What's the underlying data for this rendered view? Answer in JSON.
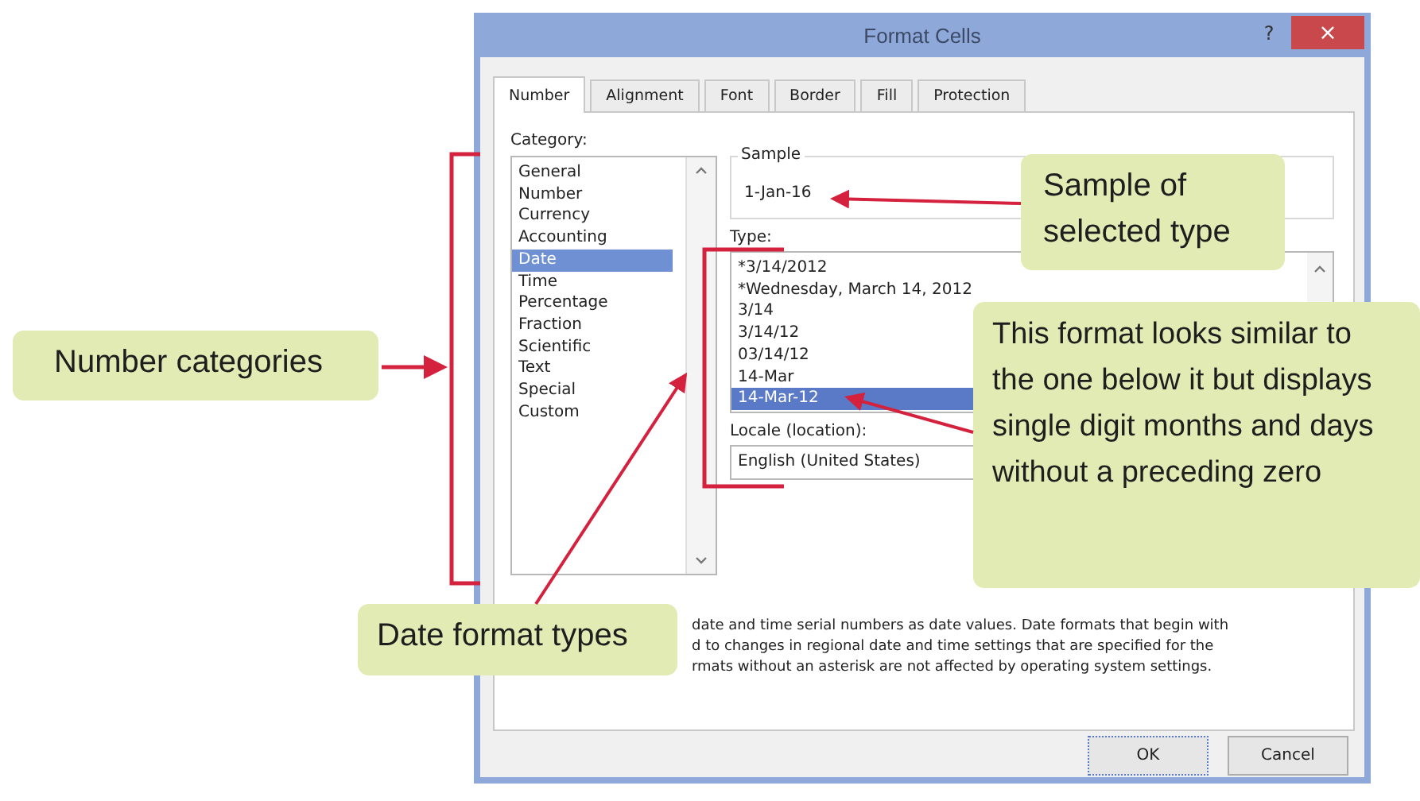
{
  "window": {
    "title": "Format Cells"
  },
  "title_buttons": [
    {
      "kind": "help",
      "label": "?"
    },
    {
      "kind": "close",
      "label": "×"
    }
  ],
  "tabs": [
    {
      "label": "Number",
      "selected": true
    },
    {
      "label": "Alignment",
      "selected": false
    },
    {
      "label": "Font",
      "selected": false
    },
    {
      "label": "Border",
      "selected": false
    },
    {
      "label": "Fill",
      "selected": false
    },
    {
      "label": "Protection",
      "selected": false
    }
  ],
  "category": {
    "label": "Category:",
    "items": [
      {
        "label": "General",
        "selected": false
      },
      {
        "label": "Number",
        "selected": false
      },
      {
        "label": "Currency",
        "selected": false
      },
      {
        "label": "Accounting",
        "selected": false
      },
      {
        "label": "Date",
        "selected": true
      },
      {
        "label": "Time",
        "selected": false
      },
      {
        "label": "Percentage",
        "selected": false
      },
      {
        "label": "Fraction",
        "selected": false
      },
      {
        "label": "Scientific",
        "selected": false
      },
      {
        "label": "Text",
        "selected": false
      },
      {
        "label": "Special",
        "selected": false
      },
      {
        "label": "Custom",
        "selected": false
      }
    ]
  },
  "sample": {
    "label": "Sample",
    "value": "1-Jan-16"
  },
  "type": {
    "label": "Type:",
    "items": [
      {
        "label": "*3/14/2012",
        "selected": false
      },
      {
        "label": "*Wednesday, March 14, 2012",
        "selected": false
      },
      {
        "label": "3/14",
        "selected": false
      },
      {
        "label": "3/14/12",
        "selected": false
      },
      {
        "label": "03/14/12",
        "selected": false
      },
      {
        "label": "14-Mar",
        "selected": false
      },
      {
        "label": "14-Mar-12",
        "selected": true
      }
    ]
  },
  "locale": {
    "label": "Locale (location):",
    "value": "English (United States)"
  },
  "description": [
    "date and time serial numbers as date values.  Date formats that begin with",
    "d to changes in regional date and time settings that are specified for the",
    "rmats without an asterisk are not affected by operating system settings."
  ],
  "buttons": [
    {
      "label": "OK",
      "kind": "default"
    },
    {
      "label": "Cancel",
      "kind": "normal"
    }
  ],
  "callouts": [
    {
      "text": "Number categories"
    },
    {
      "text": "Sample of selected type"
    },
    {
      "text": "This format looks similar to the one below it but displays single digit months and days without a preceding zero"
    },
    {
      "text": "Date format types"
    }
  ]
}
